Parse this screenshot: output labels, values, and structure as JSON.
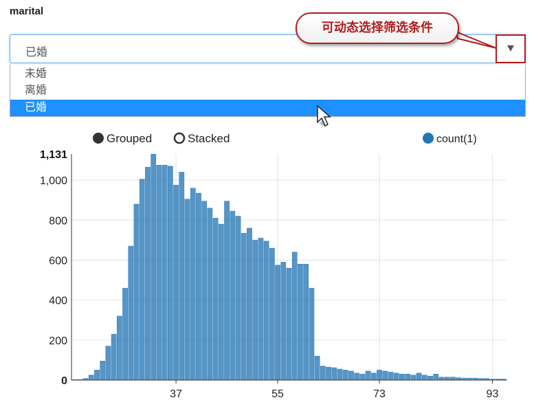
{
  "filter": {
    "label": "marital",
    "selected": "已婚",
    "options": [
      "未婚",
      "离婚",
      "已婚"
    ],
    "selected_index": 2
  },
  "annotation": {
    "text": "可动态选择筛选条件",
    "color": "#b01c1c"
  },
  "icons": {
    "dropdown": "chevron-down-icon",
    "cursor": "mouse-pointer-icon"
  },
  "controls": {
    "grouped_label": "Grouped",
    "stacked_label": "Stacked",
    "grouped_selected": true
  },
  "chart_data": {
    "type": "bar",
    "legend": [
      "count(1)"
    ],
    "legend_placement": "top-right",
    "bar_color": "#2c7bb6",
    "y_max_label": "1,131",
    "ylim": [
      0,
      1131
    ],
    "xlim": [
      19,
      95
    ],
    "x_ticks": [
      37,
      55,
      73,
      93
    ],
    "y_ticks": [
      0,
      200,
      400,
      600,
      800,
      1000
    ],
    "y_tick_labels": [
      "0",
      "200",
      "400",
      "600",
      "800",
      "1,000"
    ],
    "grid": true,
    "x": [
      19,
      20,
      21,
      22,
      23,
      24,
      25,
      26,
      27,
      28,
      29,
      30,
      31,
      32,
      33,
      34,
      35,
      36,
      37,
      38,
      39,
      40,
      41,
      42,
      43,
      44,
      45,
      46,
      47,
      48,
      49,
      50,
      51,
      52,
      53,
      54,
      55,
      56,
      57,
      58,
      59,
      60,
      61,
      62,
      63,
      64,
      65,
      66,
      67,
      68,
      69,
      70,
      71,
      72,
      73,
      74,
      75,
      76,
      77,
      78,
      79,
      80,
      81,
      82,
      83,
      84,
      85,
      86,
      87,
      88,
      89,
      90,
      91,
      92,
      93,
      94,
      95
    ],
    "values": [
      2,
      3,
      8,
      25,
      50,
      95,
      170,
      230,
      320,
      460,
      670,
      880,
      1005,
      1065,
      1130,
      1075,
      1075,
      1070,
      975,
      1040,
      905,
      960,
      935,
      895,
      860,
      810,
      780,
      895,
      845,
      820,
      735,
      760,
      700,
      710,
      695,
      660,
      575,
      590,
      560,
      640,
      580,
      580,
      460,
      120,
      70,
      65,
      62,
      55,
      50,
      45,
      35,
      30,
      45,
      35,
      50,
      45,
      40,
      35,
      30,
      30,
      25,
      35,
      25,
      20,
      30,
      15,
      15,
      15,
      12,
      10,
      10,
      10,
      8,
      8,
      5,
      5,
      5
    ]
  }
}
